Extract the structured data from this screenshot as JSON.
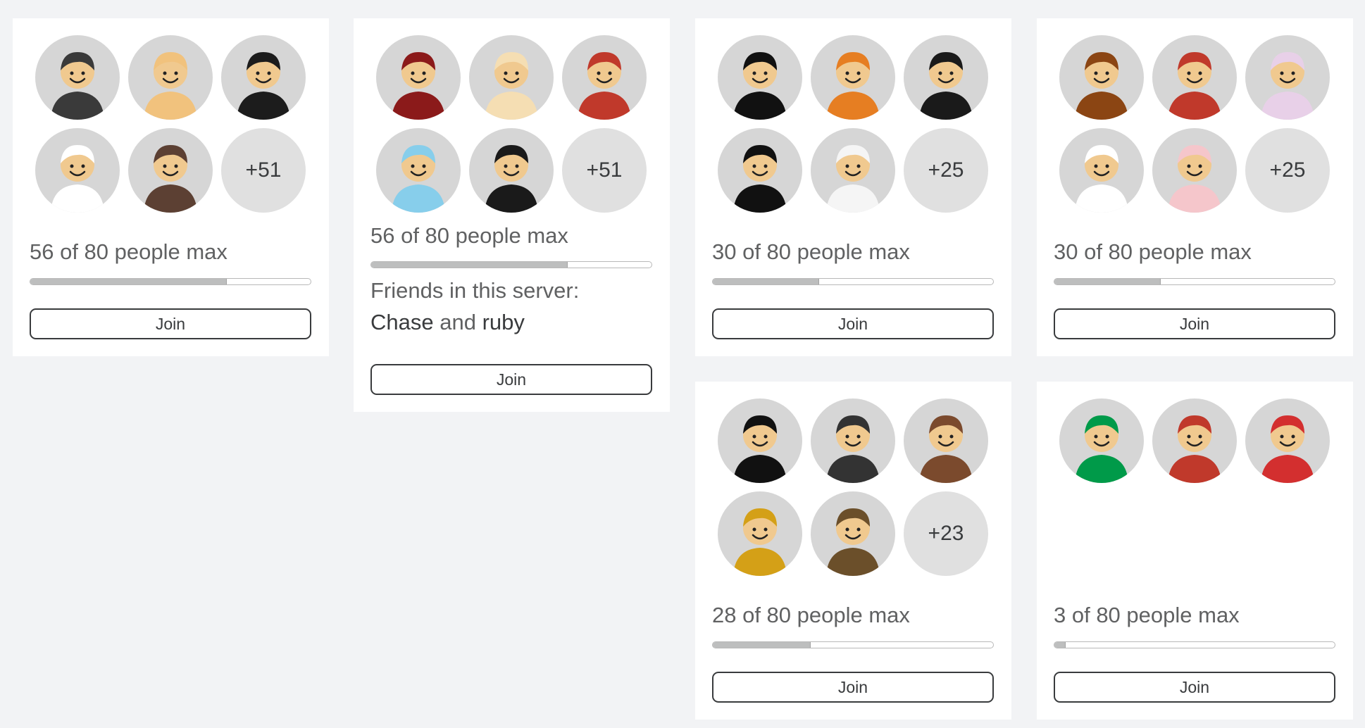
{
  "cards": [
    {
      "count_text": "56 of 80 people max",
      "fill_fraction": 0.7,
      "overflow_badge": "+51",
      "join_label": "Join",
      "avatar_colors": [
        "#3a3a3a",
        "#f1c27d",
        "#1c1c1c",
        "#ffffff",
        "#5c4033"
      ]
    },
    {
      "count_text": "56 of 80 people max",
      "fill_fraction": 0.7,
      "overflow_badge": "+51",
      "friends_label": "Friends in this server:",
      "friend_1": "Chase",
      "friends_and": "and",
      "friend_2": "ruby",
      "join_label": "Join",
      "avatar_colors": [
        "#8b1a1a",
        "#f5deb3",
        "#c0392b",
        "#87ceeb",
        "#1a1a1a"
      ]
    },
    {
      "count_text": "30 of 80 people max",
      "fill_fraction": 0.38,
      "overflow_badge": "+25",
      "join_label": "Join",
      "avatar_colors": [
        "#111111",
        "#e67e22",
        "#1a1a1a",
        "#111111",
        "#f5f5f5"
      ]
    },
    {
      "count_text": "30 of 80 people max",
      "fill_fraction": 0.38,
      "overflow_badge": "+25",
      "join_label": "Join",
      "avatar_colors": [
        "#8b4513",
        "#c0392b",
        "#e8d0e8",
        "#ffffff",
        "#f5c6cb"
      ]
    },
    {
      "count_text": "28 of 80 people max",
      "fill_fraction": 0.35,
      "overflow_badge": "+23",
      "join_label": "Join",
      "avatar_colors": [
        "#111111",
        "#333333",
        "#7b4a2d",
        "#d4a017",
        "#6b4f2a"
      ]
    },
    {
      "count_text": "3 of 80 people max",
      "fill_fraction": 0.04,
      "join_label": "Join",
      "avatar_colors": [
        "#009a49",
        "#c0392b",
        "#d32f2f"
      ]
    }
  ]
}
